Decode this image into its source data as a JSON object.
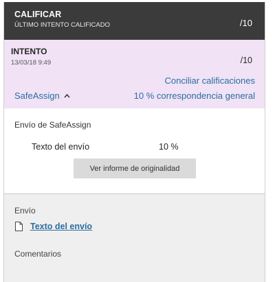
{
  "header": {
    "title": "CALIFICAR",
    "subtitle": "ÚLTIMO INTENTO CALIFICADO",
    "score": "/10"
  },
  "attempt": {
    "title": "INTENTO",
    "date": "13/03/18 9:49",
    "score": "/10",
    "reconcile_link": "Conciliar calificaciones",
    "safeassign_toggle": "SafeAssign",
    "match_link": "10 % correspondencia general"
  },
  "safeassign": {
    "heading": "Envío de SafeAssign",
    "row_label": "Texto del envío",
    "row_value": "10 %",
    "report_button": "Ver informe de originalidad"
  },
  "submission": {
    "heading": "Envío",
    "link": "Texto del envío",
    "comments_label": "Comentarios"
  },
  "colors": {
    "header_bg": "#3b3b3b",
    "attempt_bg": "#f1e2f6",
    "link": "#2a6ea0",
    "submission_bg": "#efefef"
  }
}
